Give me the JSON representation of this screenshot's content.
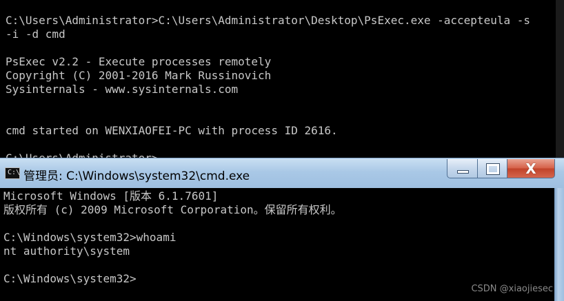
{
  "background_console": {
    "lines": [
      "C:\\Users\\Administrator>C:\\Users\\Administrator\\Desktop\\PsExec.exe -accepteula -s",
      "-i -d cmd",
      "",
      "PsExec v2.2 - Execute processes remotely",
      "Copyright (C) 2001-2016 Mark Russinovich",
      "Sysinternals - www.sysinternals.com",
      "",
      "",
      "cmd started on WENXIAOFEI-PC with process ID 2616.",
      "",
      "C:\\Users\\Administrator>"
    ]
  },
  "window": {
    "title": "管理员: C:\\Windows\\system32\\cmd.exe",
    "icon_text": "C:\\",
    "buttons": {
      "minimize": "",
      "maximize": "",
      "close": "X"
    }
  },
  "console": {
    "lines": [
      "Microsoft Windows [版本 6.1.7601]",
      "版权所有 (c) 2009 Microsoft Corporation。保留所有权利。",
      "",
      "C:\\Windows\\system32>whoami",
      "nt authority\\system",
      "",
      "C:\\Windows\\system32>"
    ]
  },
  "watermark": "CSDN @xiaojiesec",
  "colors": {
    "console_bg": "#000000",
    "console_text": "#c8c8c8",
    "titlebar": "#a9c8e6",
    "close_button": "#c1432a"
  }
}
